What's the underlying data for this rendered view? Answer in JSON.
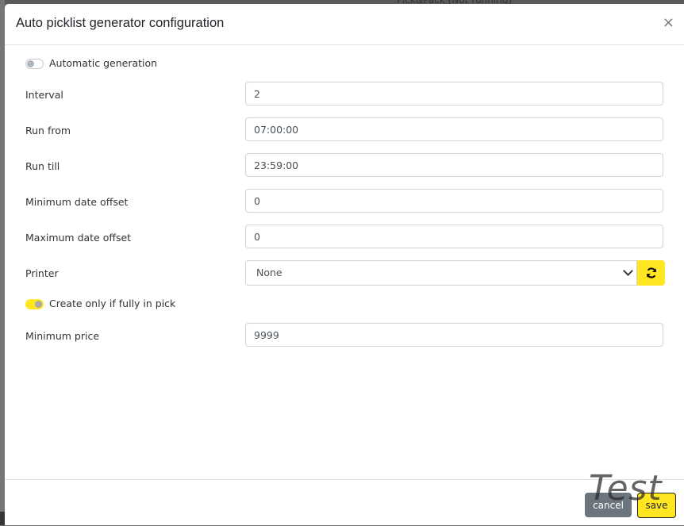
{
  "background": {
    "app_title": "Pick&Pack (Not running)"
  },
  "dialog": {
    "title": "Auto picklist generator configuration",
    "close_icon": "×",
    "fields": {
      "automatic_generation": {
        "label": "Automatic generation",
        "enabled": false
      },
      "interval": {
        "label": "Interval",
        "value": "2"
      },
      "run_from": {
        "label": "Run from",
        "value": "07:00:00"
      },
      "run_till": {
        "label": "Run till",
        "value": "23:59:00"
      },
      "minimum_date_offset": {
        "label": "Minimum date offset",
        "value": "0"
      },
      "maximum_date_offset": {
        "label": "Maximum date offset",
        "value": "0"
      },
      "printer": {
        "label": "Printer",
        "selected": "None",
        "refresh_icon": "refresh-icon"
      },
      "create_only_if_fully_in_pick": {
        "label": "Create only if fully in pick",
        "enabled": true
      },
      "minimum_price": {
        "label": "Minimum price",
        "value": "9999"
      }
    },
    "footer": {
      "cancel_label": "cancel",
      "save_label": "save"
    }
  },
  "watermark": "Test",
  "colors": {
    "accent": "#ffe620",
    "secondary": "#6c757d"
  }
}
